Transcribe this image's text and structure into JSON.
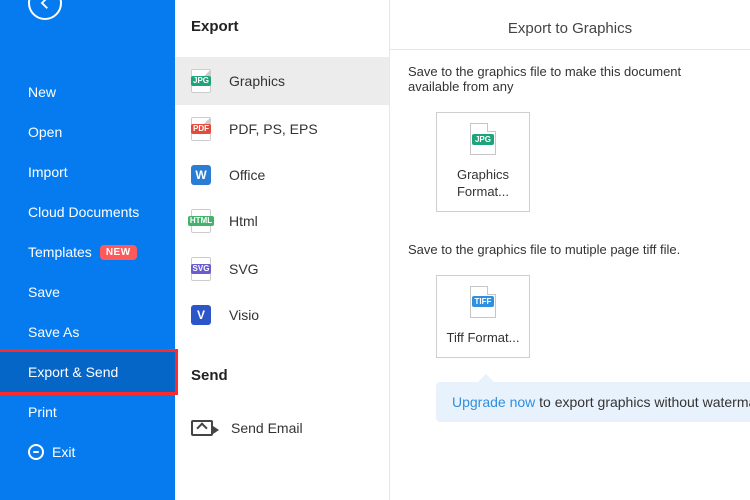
{
  "sidebar": {
    "items": [
      {
        "label": "New"
      },
      {
        "label": "Open"
      },
      {
        "label": "Import"
      },
      {
        "label": "Cloud Documents"
      },
      {
        "label": "Templates",
        "badge": "NEW"
      },
      {
        "label": "Save"
      },
      {
        "label": "Save As"
      },
      {
        "label": "Export & Send"
      },
      {
        "label": "Print"
      },
      {
        "label": "Exit"
      }
    ]
  },
  "middle": {
    "export_heading": "Export",
    "export_items": [
      {
        "label": "Graphics",
        "badge": "JPG"
      },
      {
        "label": "PDF, PS, EPS",
        "badge": "PDF"
      },
      {
        "label": "Office",
        "badge": "W"
      },
      {
        "label": "Html",
        "badge": "HTML"
      },
      {
        "label": "SVG",
        "badge": "SVG"
      },
      {
        "label": "Visio",
        "badge": "V"
      }
    ],
    "send_heading": "Send",
    "send_items": [
      {
        "label": "Send Email"
      }
    ]
  },
  "pane": {
    "title": "Export to Graphics",
    "desc1": "Save to the graphics file to make this document available from any",
    "tile1_label": "Graphics Format...",
    "desc2": "Save to the graphics file to mutiple page tiff file.",
    "tile2_label": "Tiff Format...",
    "callout_link": "Upgrade now",
    "callout_text": " to export graphics without watermark!",
    "badges": {
      "jpg": "JPG",
      "tiff": "TIFF"
    }
  }
}
